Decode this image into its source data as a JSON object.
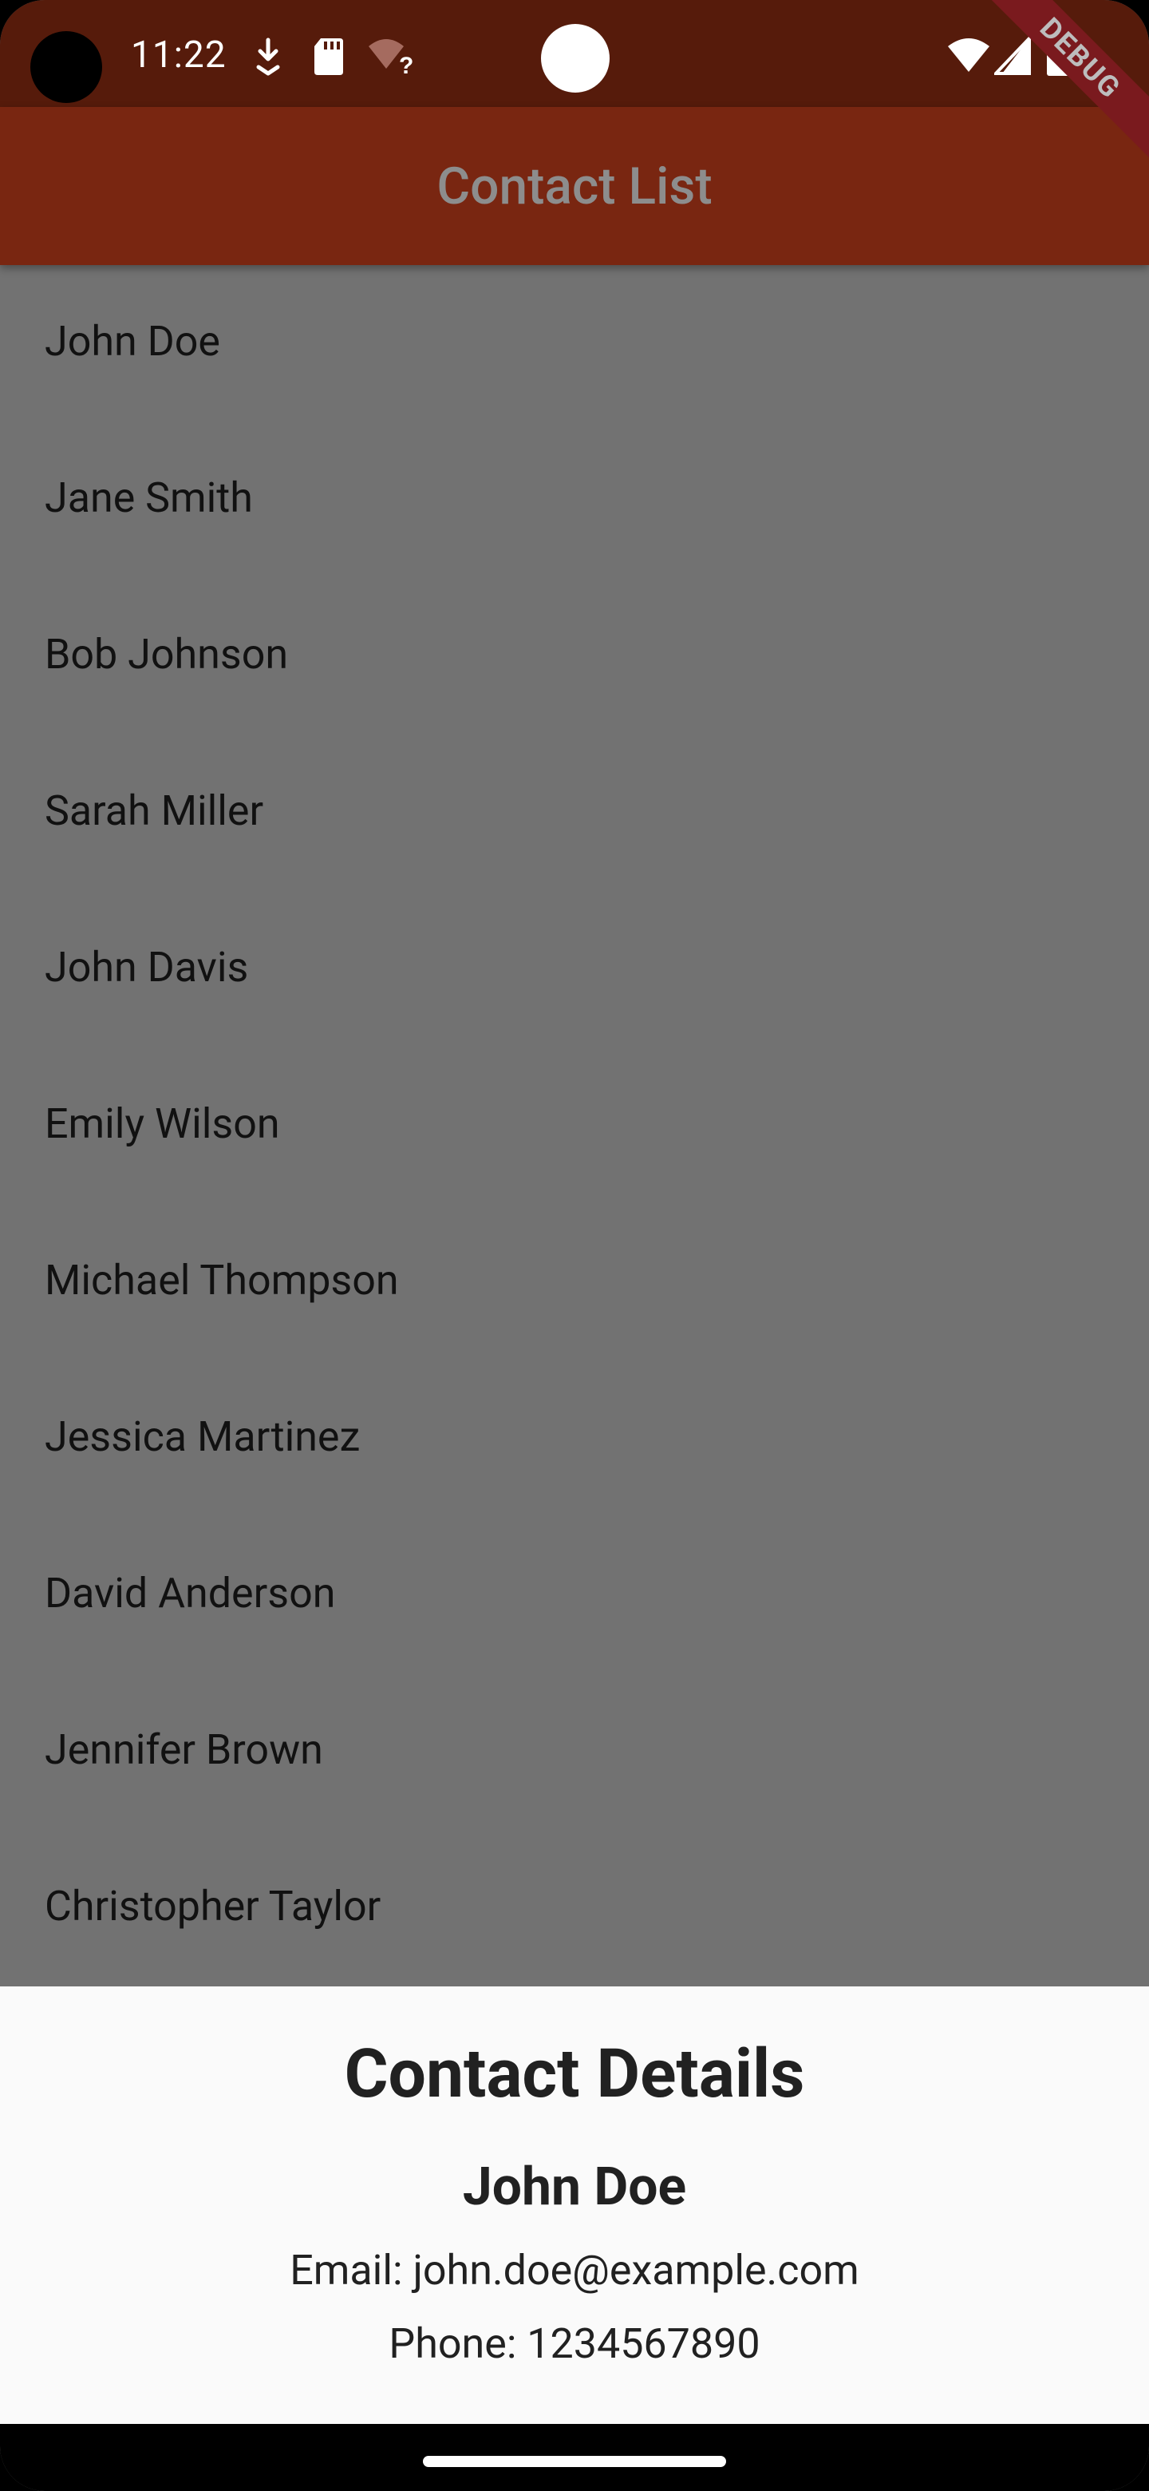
{
  "status_bar": {
    "time": "11:22",
    "icons_left": [
      "download-icon",
      "sd-card-icon",
      "wifi-unknown-icon"
    ],
    "icons_right": [
      "wifi-icon",
      "signal-icon",
      "battery-icon"
    ]
  },
  "debug_banner": {
    "label": "DEBUG"
  },
  "app_bar": {
    "title": "Contact List"
  },
  "contacts": [
    {
      "name": "John Doe"
    },
    {
      "name": "Jane Smith"
    },
    {
      "name": "Bob Johnson"
    },
    {
      "name": "Sarah Miller"
    },
    {
      "name": "John Davis"
    },
    {
      "name": "Emily Wilson"
    },
    {
      "name": "Michael Thompson"
    },
    {
      "name": "Jessica Martinez"
    },
    {
      "name": "David Anderson"
    },
    {
      "name": "Jennifer Brown"
    },
    {
      "name": "Christopher Taylor"
    }
  ],
  "bottom_sheet": {
    "title": "Contact Details",
    "name": "John Doe",
    "email": "Email: john.doe@example.com",
    "phone": "Phone: 1234567890"
  },
  "colors": {
    "status_bar": "#561b0b",
    "app_bar": "#792611",
    "scrim_background": "#727272",
    "sheet_background": "#fafafa"
  }
}
